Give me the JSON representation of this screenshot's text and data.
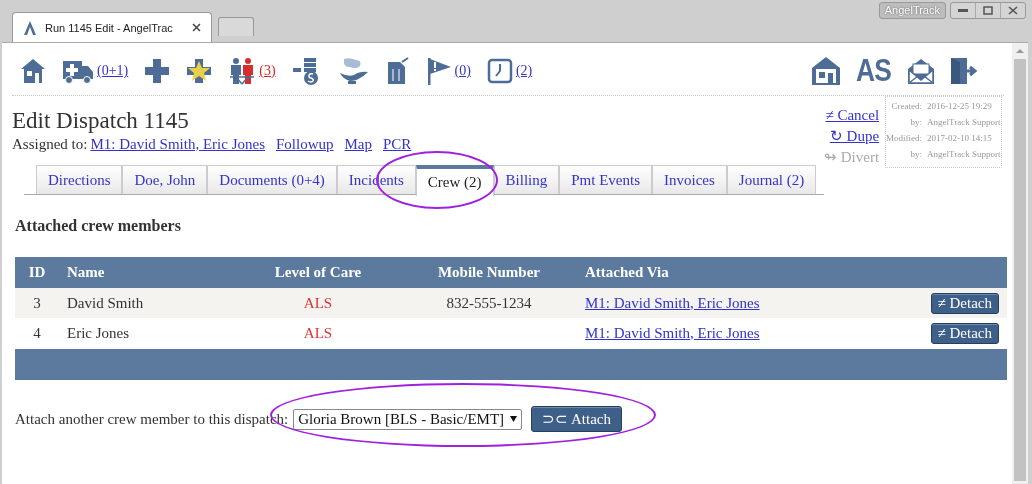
{
  "browser": {
    "tab_title": "Run 1145 Edit - AngelTrac",
    "app_badge": "AngelTrack"
  },
  "toolbar": {
    "items": [
      {
        "kind": "icon"
      },
      {
        "kind": "counter",
        "count": "(0+1)",
        "alert": false
      },
      {
        "kind": "icon"
      },
      {
        "kind": "icon"
      },
      {
        "kind": "counter",
        "count": "(3)",
        "alert": true
      },
      {
        "kind": "icon"
      },
      {
        "kind": "icon"
      },
      {
        "kind": "icon"
      },
      {
        "kind": "counter",
        "count": "(0)",
        "alert": false
      },
      {
        "kind": "counter",
        "count": "(2)",
        "alert": false
      }
    ],
    "user_initials": "AS"
  },
  "dispatch": {
    "title": "Edit Dispatch 1145",
    "assigned_label": "Assigned to:",
    "links": [
      "M1: David Smith, Eric Jones",
      "Followup",
      "Map",
      "PCR"
    ],
    "actions": [
      {
        "label": "≠ Cancel",
        "disabled": false
      },
      {
        "label": "↻ Dupe",
        "disabled": false
      },
      {
        "label": "↬ Divert",
        "disabled": true
      }
    ],
    "audit": [
      {
        "label": "Created:",
        "value": "2016-12-25 19:29"
      },
      {
        "label": "by:",
        "value": "AngelTrack Support"
      },
      {
        "label": "Modified:",
        "value": "2017-02-10 14:15"
      },
      {
        "label": "by:",
        "value": "AngelTrack Support"
      }
    ]
  },
  "tabs": [
    {
      "label": "Directions",
      "selected": false
    },
    {
      "label": "Doe, John",
      "selected": false
    },
    {
      "label": "Documents (0+4)",
      "selected": false
    },
    {
      "label": "Incidents",
      "selected": false
    },
    {
      "label": "Crew (2)",
      "selected": true
    },
    {
      "label": "Billing",
      "selected": false
    },
    {
      "label": "Pmt Events",
      "selected": false
    },
    {
      "label": "Invoices",
      "selected": false
    },
    {
      "label": "Journal (2)",
      "selected": false
    }
  ],
  "crew": {
    "heading": "Attached crew members",
    "columns": [
      "ID",
      "Name",
      "Level of Care",
      "Mobile Number",
      "Attached Via"
    ],
    "rows": [
      {
        "id": "3",
        "name": "David Smith",
        "level_of_care": "ALS",
        "mobile": "832-555-1234",
        "attached_via": "M1: David Smith, Eric Jones",
        "action": "≠ Detach"
      },
      {
        "id": "4",
        "name": "Eric Jones",
        "level_of_care": "ALS",
        "attached_via": "M1: David Smith, Eric Jones",
        "action": "≠ Detach"
      }
    ],
    "attach_prompt": "Attach another crew member to this dispatch:",
    "attach_select": "Gloria Brown [BLS - Basic/EMT]",
    "attach_button": "⊃⊂ Attach"
  }
}
